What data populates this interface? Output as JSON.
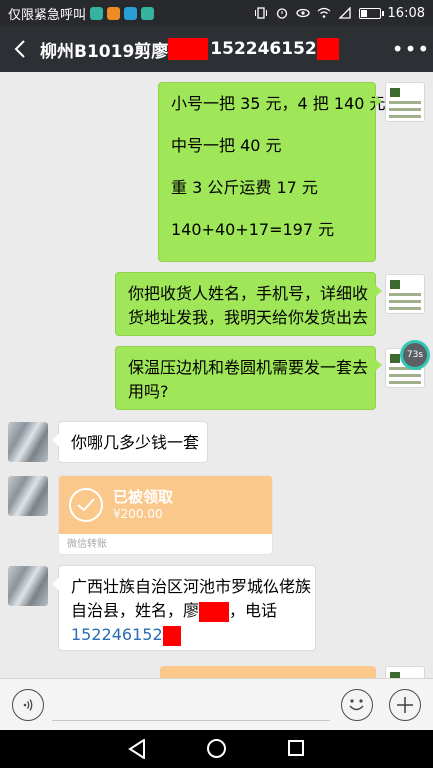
{
  "status_bar": {
    "left_text": "仅限紧急呼叫",
    "time": "16:08"
  },
  "header": {
    "title_prefix": "柳州B1019剪廖",
    "title_phone": "152246152",
    "more_label": "•••"
  },
  "messages": [
    {
      "side": "right",
      "lines": [
        "小号一把 35 元，4 把 140 元",
        "中号一把 40 元",
        "重 3 公斤运费 17 元",
        "140+40+17=197 元"
      ]
    },
    {
      "side": "right",
      "lines": [
        "你把收货人姓名，手机号，详细收",
        "货地址发我，我明天给你发货出去"
      ]
    },
    {
      "side": "right",
      "lines": [
        "保温压边机和卷圆机需要发一套去",
        "用吗?"
      ]
    },
    {
      "side": "left",
      "lines": [
        "你哪几多少钱一套"
      ]
    },
    {
      "side": "left",
      "type": "transfer",
      "status": "已被领取",
      "amount": "¥200.00",
      "footer": "微信转账"
    },
    {
      "side": "left",
      "lines": [
        "广西壮族自治区河池市罗城仫佬族",
        "自治县，姓名，廖",
        "，电话",
        "152246152"
      ]
    }
  ],
  "floating_timer": "73s",
  "icons": {
    "back": "back-arrow-icon",
    "voice": "voice-icon",
    "emoji": "emoji-icon",
    "plus": "plus-icon"
  },
  "colors": {
    "green_bubble": "#9fe658",
    "transfer": "#fbc88c",
    "header": "#2c2f33",
    "redaction": "#ff0000"
  }
}
